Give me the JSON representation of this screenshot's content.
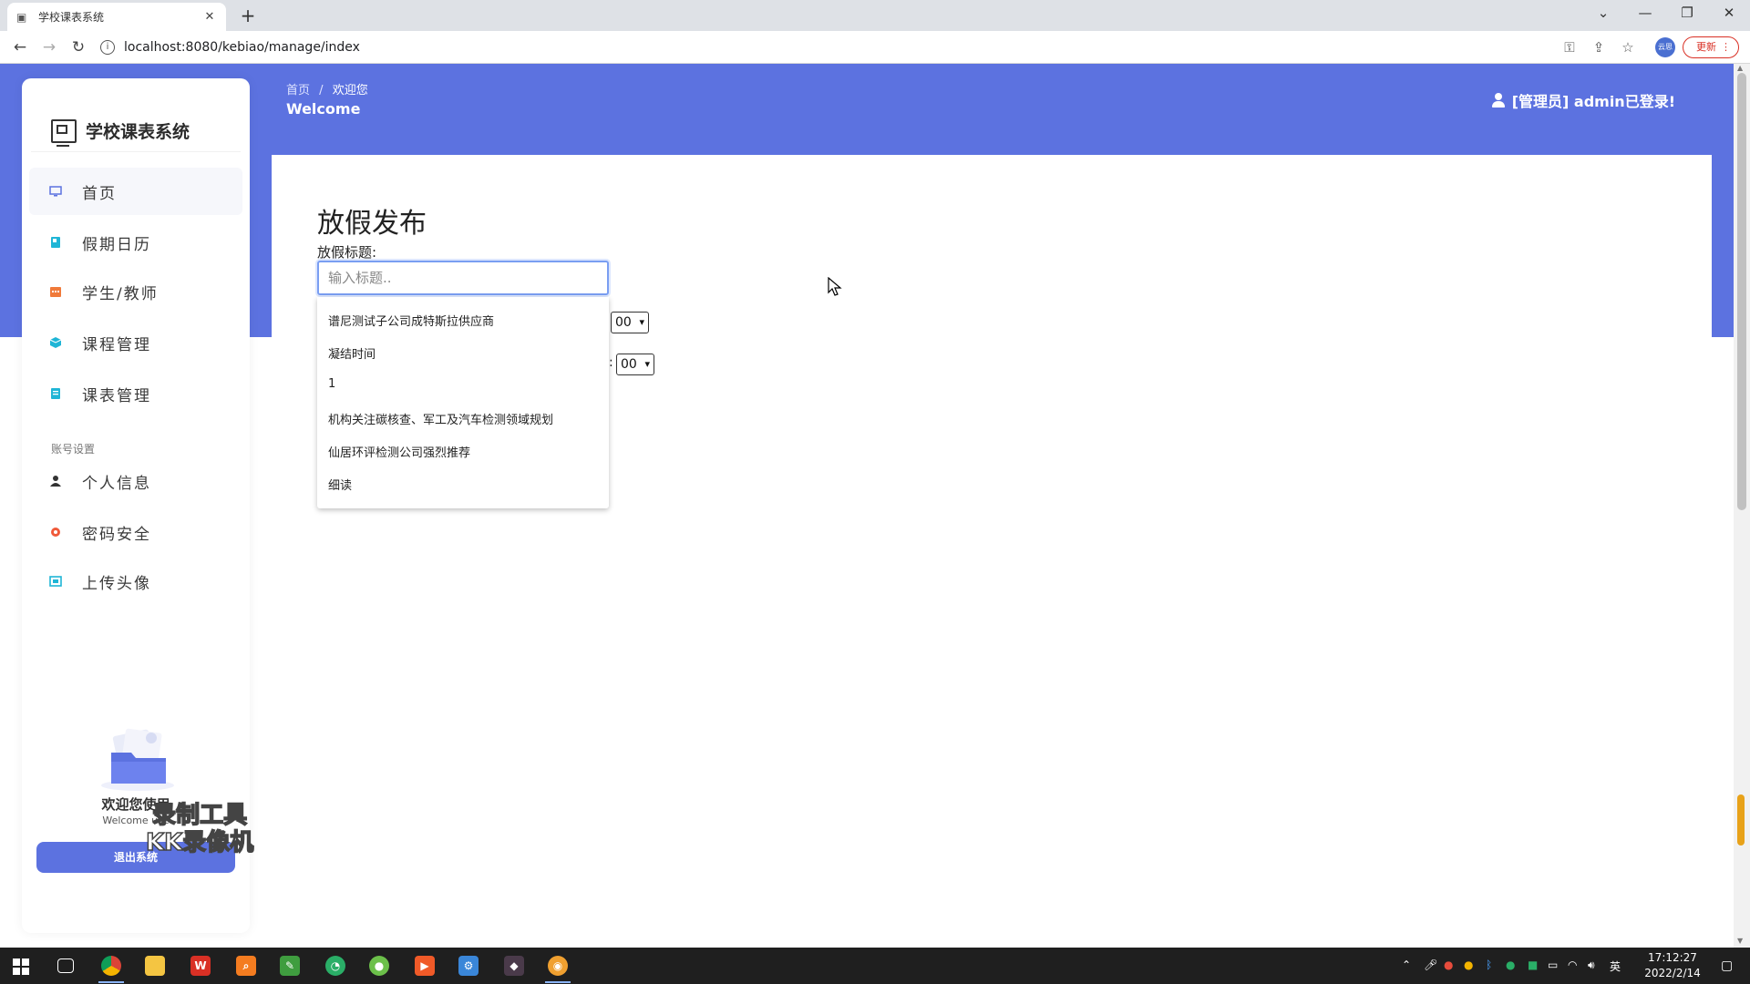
{
  "browser": {
    "tab_title": "学校课表系统",
    "url": "localhost:8080/kebiao/manage/index",
    "profile_label": "云思",
    "update_label": "更新"
  },
  "app": {
    "logo_text": "学校课表系统",
    "breadcrumb": {
      "home": "首页",
      "separator": "/",
      "current": "欢迎您"
    },
    "page_welcome": "Welcome",
    "user_info": "[管理员] admin已登录!",
    "nav": [
      {
        "label": "首页",
        "icon": "monitor-icon",
        "color": "#5c72e0"
      },
      {
        "label": "假期日历",
        "icon": "calendar-book-icon",
        "color": "#1fb5d6"
      },
      {
        "label": "学生/教师",
        "icon": "calendar-icon",
        "color": "#f07a3a"
      },
      {
        "label": "课程管理",
        "icon": "cube-icon",
        "color": "#1fb5d6"
      },
      {
        "label": "课表管理",
        "icon": "document-icon",
        "color": "#1fb5d6"
      }
    ],
    "account_group_label": "账号设置",
    "account_nav": [
      {
        "label": "个人信息",
        "icon": "user-icon",
        "color": "#333333"
      },
      {
        "label": "密码安全",
        "icon": "gear-icon",
        "color": "#f05a3a"
      },
      {
        "label": "上传头像",
        "icon": "image-icon",
        "color": "#1fb5d6"
      }
    ],
    "promo_title": "欢迎您使用",
    "promo_subtitle": "Welcome use",
    "logout_label": "退出系统",
    "accent_color": "#5c72e0"
  },
  "form": {
    "heading": "放假发布",
    "title_label": "放假标题:",
    "title_placeholder": "输入标题..",
    "minute_select_1": "00",
    "minute_select_2": "00",
    "colon": ":"
  },
  "autocomplete": [
    "谱尼测试子公司成特斯拉供应商",
    "凝结时间",
    "1",
    "机构关注碳核查、军工及汽车检测领域规划",
    "仙居环评检测公司强烈推荐",
    "细读"
  ],
  "watermark": {
    "line1": "录制工具",
    "line2": "KK录像机"
  },
  "taskbar": {
    "time": "17:12:27",
    "date": "2022/2/14",
    "ime": "英"
  }
}
